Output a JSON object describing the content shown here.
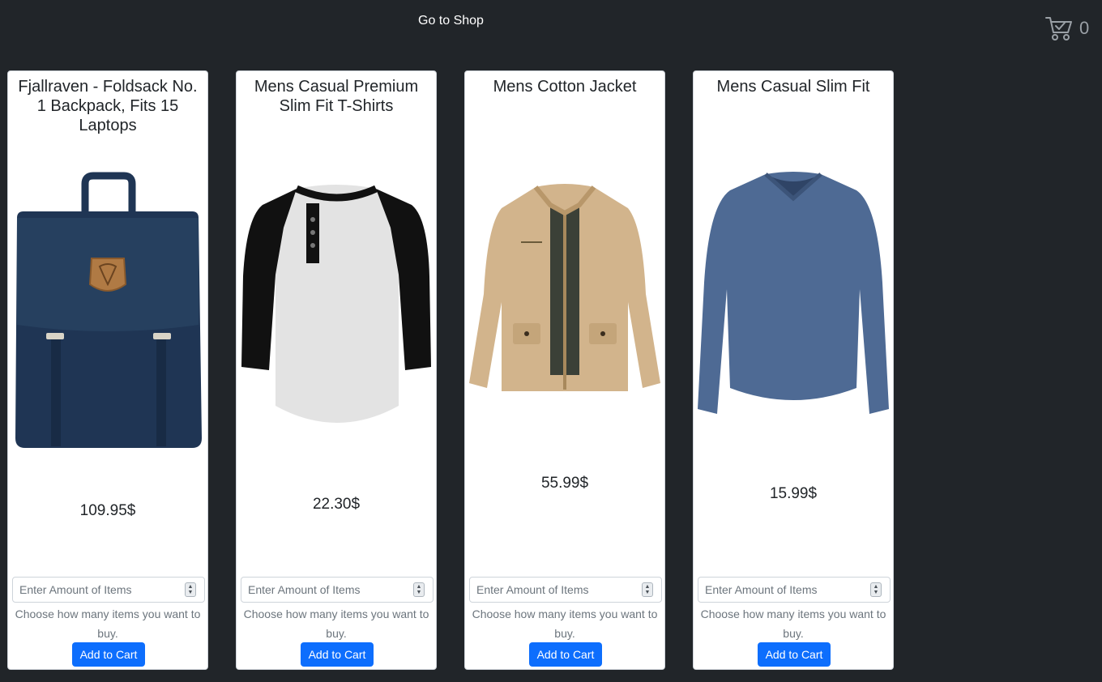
{
  "nav": {
    "shop_link": "Go to Shop"
  },
  "cart": {
    "count": "0"
  },
  "products": [
    {
      "title": "Fjallraven - Foldsack No. 1 Backpack, Fits 15 Laptops",
      "price": "109.95$",
      "qty_placeholder": "Enter Amount of Items",
      "help": "Choose how many items you want to buy.",
      "button": "Add to Cart"
    },
    {
      "title": "Mens Casual Premium Slim Fit T-Shirts",
      "price": "22.30$",
      "qty_placeholder": "Enter Amount of Items",
      "help": "Choose how many items you want to buy.",
      "button": "Add to Cart"
    },
    {
      "title": "Mens Cotton Jacket",
      "price": "55.99$",
      "qty_placeholder": "Enter Amount of Items",
      "help": "Choose how many items you want to buy.",
      "button": "Add to Cart"
    },
    {
      "title": "Mens Casual Slim Fit",
      "price": "15.99$",
      "qty_placeholder": "Enter Amount of Items",
      "help": "Choose how many items you want to buy.",
      "button": "Add to Cart"
    }
  ],
  "colors": {
    "background": "#212529",
    "button": "#0d6efd",
    "backpack": "#1f3554",
    "tshirt_body": "#e3e3e3",
    "tshirt_sleeve": "#111111",
    "jacket": "#d2b48c",
    "longsleeve": "#4e6a94"
  },
  "icons": {
    "cart": "cart-check-icon"
  }
}
